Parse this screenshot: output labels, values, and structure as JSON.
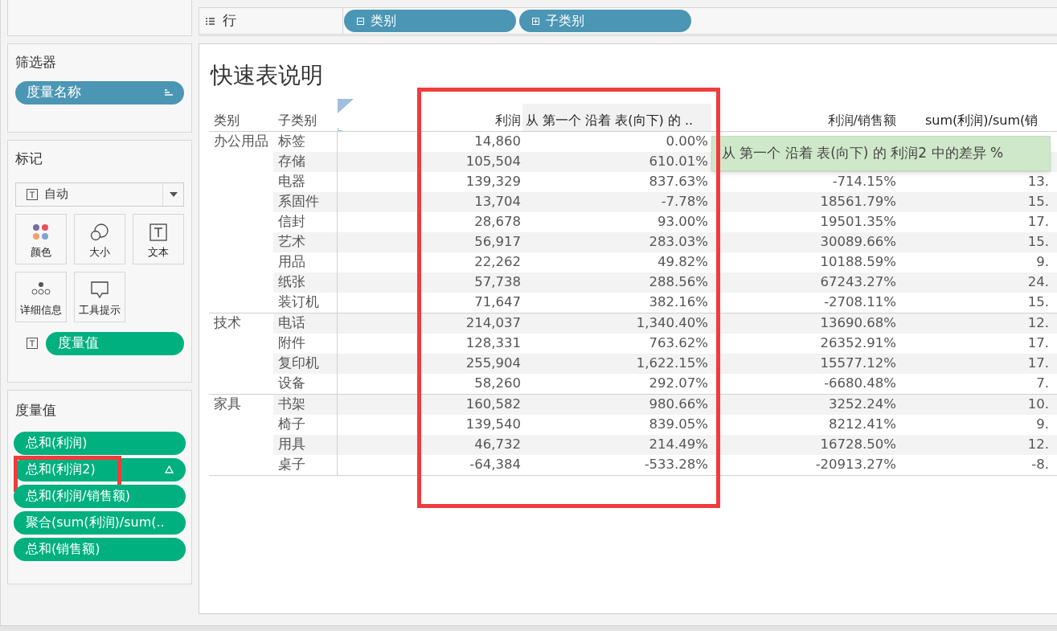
{
  "rows_shelf": {
    "label": "行",
    "pills": [
      {
        "label": "类别",
        "expanded": true
      },
      {
        "label": "子类别",
        "expanded": false
      }
    ]
  },
  "filters": {
    "title": "筛选器",
    "pills": [
      {
        "label": "度量名称"
      }
    ]
  },
  "marks": {
    "title": "标记",
    "mark_type": "自动",
    "buttons": [
      {
        "label": "颜色",
        "kind": "color"
      },
      {
        "label": "大小",
        "kind": "size"
      },
      {
        "label": "文本",
        "kind": "text"
      },
      {
        "label": "详细信息",
        "kind": "detail"
      },
      {
        "label": "工具提示",
        "kind": "tooltip"
      }
    ],
    "text_pill": "度量值"
  },
  "measure_values": {
    "title": "度量值",
    "pills": [
      {
        "label": "总和(利润)",
        "delta": false,
        "highlighted": false
      },
      {
        "label": "总和(利润2)",
        "delta": true,
        "highlighted": true
      },
      {
        "label": "总和(利润/销售额)",
        "delta": false,
        "highlighted": false
      },
      {
        "label": "聚合(sum(利润)/sum(..",
        "delta": false,
        "highlighted": false
      },
      {
        "label": "总和(销售额)",
        "delta": false,
        "highlighted": false
      }
    ]
  },
  "view": {
    "title": "快速表说明",
    "table": {
      "columns": [
        "类别",
        "子类别",
        "利润",
        "从 第一个 沿着 表(向下) 的 ..",
        "利润/销售额",
        "sum(利润)/sum(销"
      ],
      "groups": [
        {
          "category": "办公用品",
          "rows": [
            {
              "subcategory": "标签",
              "profit": "14,860",
              "diff": "0.00%"
            },
            {
              "subcategory": "存储",
              "profit": "105,504",
              "diff": "610.01%"
            },
            {
              "subcategory": "电器",
              "profit": "139,329",
              "diff": "837.63%",
              "ratio": "-714.15%",
              "sum_ratio": "13."
            },
            {
              "subcategory": "系固件",
              "profit": "13,704",
              "diff": "-7.78%",
              "ratio": "18561.79%",
              "sum_ratio": "15."
            },
            {
              "subcategory": "信封",
              "profit": "28,678",
              "diff": "93.00%",
              "ratio": "19501.35%",
              "sum_ratio": "17."
            },
            {
              "subcategory": "艺术",
              "profit": "56,917",
              "diff": "283.03%",
              "ratio": "30089.66%",
              "sum_ratio": "15."
            },
            {
              "subcategory": "用品",
              "profit": "22,262",
              "diff": "49.82%",
              "ratio": "10188.59%",
              "sum_ratio": "9."
            },
            {
              "subcategory": "纸张",
              "profit": "57,738",
              "diff": "288.56%",
              "ratio": "67243.27%",
              "sum_ratio": "24."
            },
            {
              "subcategory": "装订机",
              "profit": "71,647",
              "diff": "382.16%",
              "ratio": "-2708.11%",
              "sum_ratio": "15."
            }
          ]
        },
        {
          "category": "技术",
          "rows": [
            {
              "subcategory": "电话",
              "profit": "214,037",
              "diff": "1,340.40%",
              "ratio": "13690.68%",
              "sum_ratio": "12."
            },
            {
              "subcategory": "附件",
              "profit": "128,331",
              "diff": "763.62%",
              "ratio": "26352.91%",
              "sum_ratio": "17."
            },
            {
              "subcategory": "复印机",
              "profit": "255,904",
              "diff": "1,622.15%",
              "ratio": "15577.12%",
              "sum_ratio": "17."
            },
            {
              "subcategory": "设备",
              "profit": "58,260",
              "diff": "292.07%",
              "ratio": "-6680.48%",
              "sum_ratio": "7."
            }
          ]
        },
        {
          "category": "家具",
          "rows": [
            {
              "subcategory": "书架",
              "profit": "160,582",
              "diff": "980.66%",
              "ratio": "3252.24%",
              "sum_ratio": "10."
            },
            {
              "subcategory": "椅子",
              "profit": "139,540",
              "diff": "839.05%",
              "ratio": "8212.41%",
              "sum_ratio": "9."
            },
            {
              "subcategory": "用具",
              "profit": "46,732",
              "diff": "214.49%",
              "ratio": "16728.50%",
              "sum_ratio": "12."
            },
            {
              "subcategory": "桌子",
              "profit": "-64,384",
              "diff": "-533.28%",
              "ratio": "-20913.27%",
              "sum_ratio": "-8."
            }
          ]
        }
      ]
    },
    "tooltip": "从 第一个 沿着 表(向下) 的 利润2 中的差异 %",
    "highlight_column": true
  }
}
